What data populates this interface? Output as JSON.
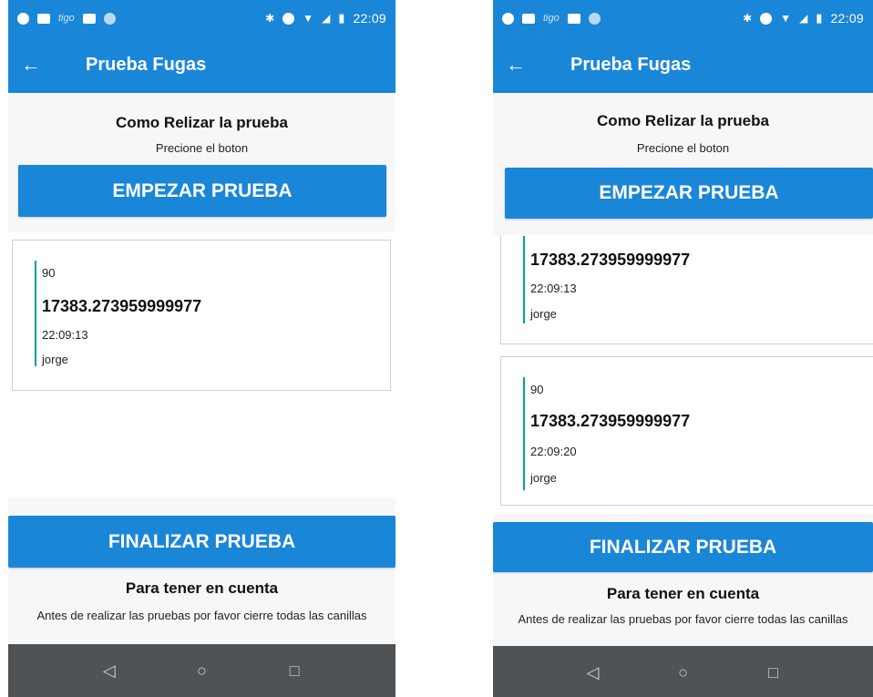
{
  "status": {
    "time": "22:09",
    "carrier": "tigo"
  },
  "appbar": {
    "title": "Prueba Fugas",
    "back_icon": "arrow-left-icon"
  },
  "header": {
    "title": "Como Relizar la prueba",
    "subtitle": "Precione el boton"
  },
  "buttons": {
    "start": "EMPEZAR PRUEBA",
    "finish": "FINALIZAR PRUEBA"
  },
  "note": {
    "title": "Para tener en cuenta",
    "text": "Antes de realizar las pruebas por favor cierre todas las canillas"
  },
  "screens": [
    {
      "cards": [
        {
          "num": "90",
          "value": "17383.273959999977",
          "time": "22:09:13",
          "user": "jorge"
        }
      ]
    },
    {
      "cards": [
        {
          "value": "17383.273959999977",
          "time": "22:09:13",
          "user": "jorge"
        },
        {
          "num": "90",
          "value": "17383.273959999977",
          "time": "22:09:20",
          "user": "jorge"
        }
      ]
    }
  ],
  "colors": {
    "primary": "#1a86d8",
    "accent_bar": "#00a0a0",
    "navbar": "#4f5356"
  }
}
